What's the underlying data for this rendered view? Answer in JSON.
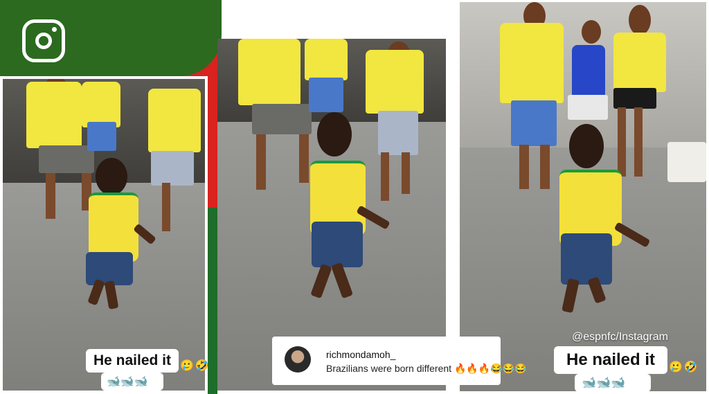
{
  "brand": {
    "icon": "instagram-icon",
    "colors": {
      "green": "#2b6a1f",
      "red": "#d8231f"
    }
  },
  "panels": [
    {
      "caption": "He nailed it",
      "emoji": "🥲🤣",
      "reactions": "🐋🐋🐋"
    },
    {
      "comment": {
        "username": "richmondamoh_",
        "text": "Brazilians were born different",
        "emoji": "🔥🔥🔥😂😂😂"
      }
    },
    {
      "caption": "He nailed it",
      "emoji": "🥲🤣",
      "reactions": "🐋🐋🐋",
      "credit": "@espnfc/Instagram"
    }
  ],
  "colors": {
    "jersey": "#f4e03a",
    "jersey_trim": "#1a9a3a",
    "shorts": "#2d4a78"
  }
}
